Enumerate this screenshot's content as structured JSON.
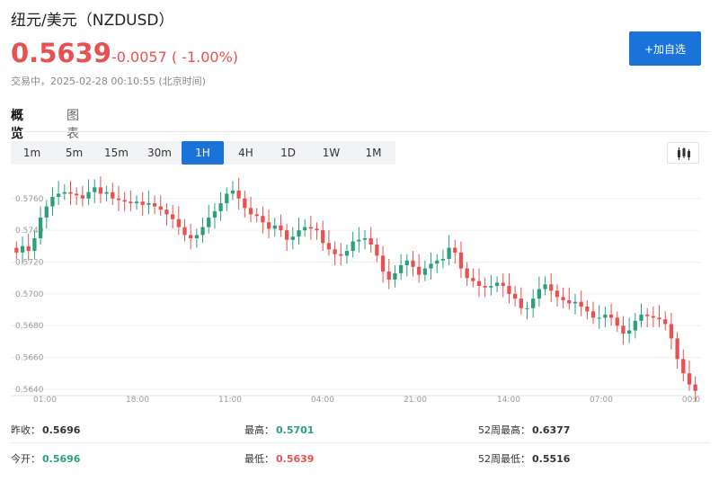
{
  "header": {
    "title": "纽元/美元（NZDUSD）",
    "price": "0.5639",
    "change": "-0.0057 ( -1.00%)",
    "status_time": "交易中，2025-02-28 00:10:55 (北京时间)",
    "add_button": "+加自选"
  },
  "tabs": [
    {
      "label": "概览",
      "active": true
    },
    {
      "label": "图表",
      "active": false
    }
  ],
  "periods": [
    {
      "label": "1m",
      "active": false
    },
    {
      "label": "5m",
      "active": false
    },
    {
      "label": "15m",
      "active": false
    },
    {
      "label": "30m",
      "active": false
    },
    {
      "label": "1H",
      "active": true
    },
    {
      "label": "4H",
      "active": false
    },
    {
      "label": "1D",
      "active": false
    },
    {
      "label": "1W",
      "active": false
    },
    {
      "label": "1M",
      "active": false
    }
  ],
  "chart_type_icon": "candlestick-icon",
  "colors": {
    "up": "#2ca07c",
    "down": "#e8514f",
    "accent": "#1a73d9"
  },
  "chart_data": {
    "type": "candlestick",
    "y_ticks": [
      "0.5760",
      "0.5740",
      "0.5720",
      "0.5700",
      "0.5680",
      "0.5660",
      "0.5640"
    ],
    "x_ticks": [
      "01:00",
      "18:00",
      "11:00",
      "04:00",
      "21:00",
      "14:00",
      "07:00",
      "00:0"
    ],
    "ylim": [
      0.5636,
      0.5774
    ],
    "grid": true,
    "close": [
      0.5726,
      0.573,
      0.5727,
      0.5735,
      0.5748,
      0.5755,
      0.5761,
      0.5763,
      0.5764,
      0.5763,
      0.5762,
      0.576,
      0.5764,
      0.5767,
      0.5763,
      0.5764,
      0.576,
      0.5759,
      0.5758,
      0.5757,
      0.5758,
      0.5756,
      0.5757,
      0.5755,
      0.5753,
      0.575,
      0.5747,
      0.5742,
      0.5737,
      0.5735,
      0.5737,
      0.5742,
      0.5748,
      0.5752,
      0.5757,
      0.5763,
      0.5765,
      0.576,
      0.5754,
      0.575,
      0.5749,
      0.5745,
      0.5741,
      0.5743,
      0.574,
      0.5734,
      0.5736,
      0.574,
      0.5742,
      0.5741,
      0.574,
      0.5732,
      0.5728,
      0.5725,
      0.5724,
      0.5727,
      0.5733,
      0.5734,
      0.5735,
      0.5731,
      0.5724,
      0.5714,
      0.5709,
      0.5713,
      0.5718,
      0.5721,
      0.5717,
      0.5712,
      0.5716,
      0.5719,
      0.5721,
      0.5722,
      0.5729,
      0.5726,
      0.5716,
      0.571,
      0.5708,
      0.5705,
      0.5704,
      0.5705,
      0.5707,
      0.5705,
      0.57,
      0.5697,
      0.5691,
      0.5691,
      0.5697,
      0.5703,
      0.5706,
      0.5702,
      0.5698,
      0.5696,
      0.5694,
      0.5695,
      0.5692,
      0.5689,
      0.5685,
      0.5685,
      0.5687,
      0.5685,
      0.568,
      0.5675,
      0.5677,
      0.5683,
      0.5687,
      0.5686,
      0.5685,
      0.5684,
      0.5681,
      0.5672,
      0.5659,
      0.565,
      0.5643,
      0.5639
    ]
  },
  "stats": {
    "prev_close_label": "昨收：",
    "prev_close": "0.5696",
    "high_label": "最高：",
    "high": "0.5701",
    "high52_label": "52周最高：",
    "high52": "0.6377",
    "open_label": "今开：",
    "open": "0.5696",
    "low_label": "最低：",
    "low": "0.5639",
    "low52_label": "52周最低：",
    "low52": "0.5516"
  }
}
